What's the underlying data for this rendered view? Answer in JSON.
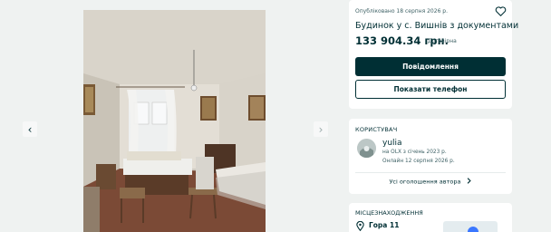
{
  "gallery": {
    "prev_icon": "chevron-left-icon",
    "next_icon": "chevron-right-icon",
    "prev_glyph": "‹",
    "next_glyph": "›"
  },
  "ad": {
    "published": "Опубліковано 18 серпня 2026 р.",
    "favorite_icon": "heart-icon",
    "title": "Будинок у с. Вишнів з документами",
    "price": "133 904.34 грн.",
    "negotiable": "Договірна",
    "message_button": "Повідомлення",
    "phone_button": "Показати телефон"
  },
  "user": {
    "section_title": "Користувач",
    "name": "yulia",
    "since": "на OLX з січень 2023 р.",
    "online": "Онлайн 12 серпня 2026 р.",
    "all_ads_link": "Усі оголошення автора",
    "all_ads_icon": "chevron-right-icon"
  },
  "location": {
    "section_title": "Місцезнаходження",
    "place": "Гора 11",
    "pin_icon": "location-pin-icon"
  },
  "colors": {
    "brand_dark": "#002f34",
    "background": "#eff2f1",
    "muted_text": "#406367"
  }
}
